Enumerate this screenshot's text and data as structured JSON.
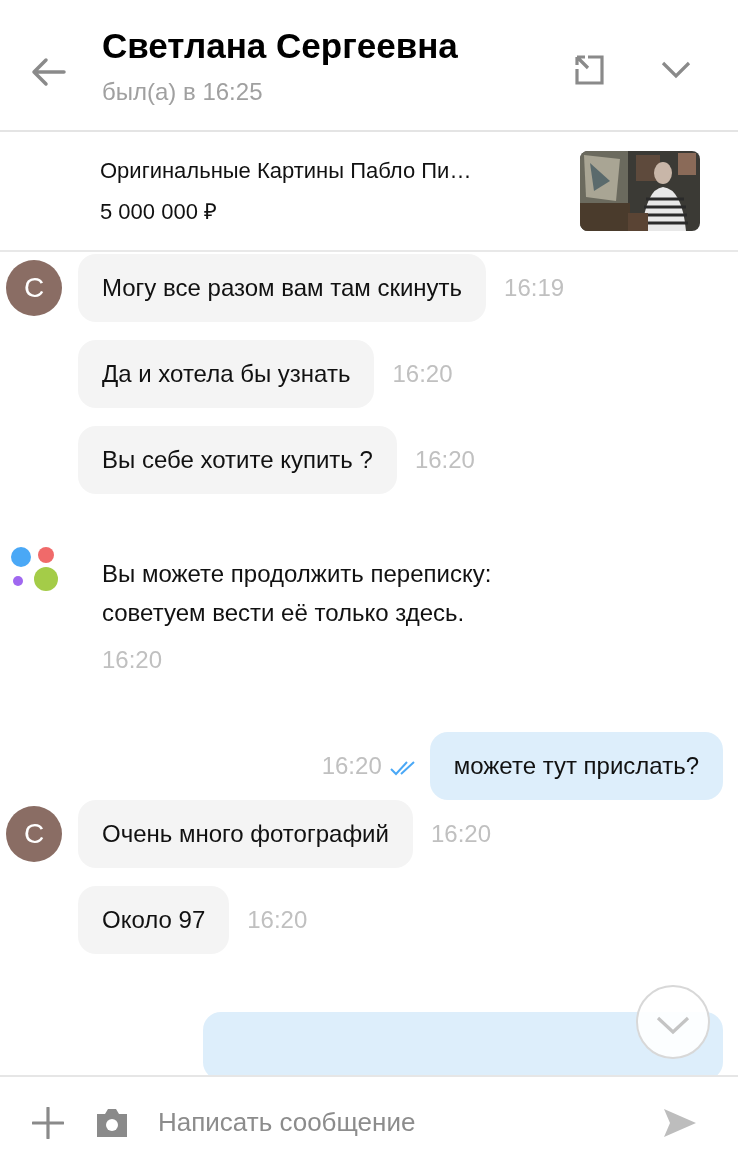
{
  "header": {
    "title": "Светлана Сергеевна",
    "status": "был(а) в 16:25"
  },
  "listing": {
    "title": "Оригинальные Картины Пабло Пи…",
    "price": "5 000 000 ₽",
    "kind": "picture"
  },
  "messages": [
    {
      "kind": "incoming",
      "avatar": "C",
      "text": "Могу все разом вам там скинуть",
      "time": "16:19"
    },
    {
      "kind": "incoming",
      "text": "Да и хотела бы узнать",
      "time": "16:20"
    },
    {
      "kind": "incoming",
      "text": "Вы себе хотите купить ?",
      "time": "16:20"
    },
    {
      "kind": "system",
      "text": "Вы можете продолжить переписку: советуем вести её только здесь.",
      "time": "16:20"
    },
    {
      "kind": "outgoing",
      "text": "можете тут прислать?",
      "time": "16:20",
      "read": true
    },
    {
      "kind": "incoming",
      "avatar": "C",
      "text": "Очень много фотографий",
      "time": "16:20"
    },
    {
      "kind": "incoming",
      "text": "Около 97",
      "time": "16:20"
    },
    {
      "kind": "outgoing_cut"
    }
  ],
  "composer": {
    "placeholder": "Написать сообщение"
  }
}
